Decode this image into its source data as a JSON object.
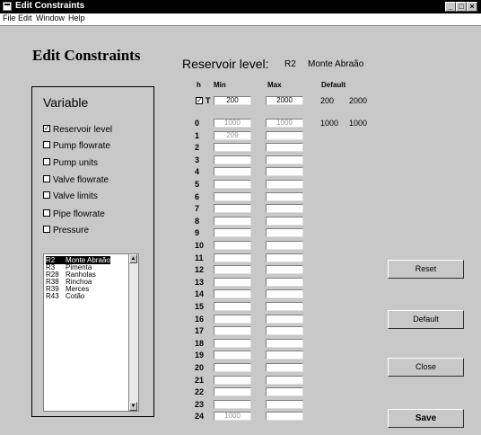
{
  "window": {
    "title": "Edit Constraints",
    "controls": [
      "_",
      "□",
      "×"
    ]
  },
  "menu": [
    "File",
    "Edit",
    "Window",
    "Help"
  ],
  "heading": "Edit Constraints",
  "reservoir": {
    "label": "Reservoir level:",
    "code": "R2",
    "name": "Monte Abraão"
  },
  "variable": {
    "title": "Variable",
    "options": [
      {
        "label": "Reservoir level",
        "checked": true
      },
      {
        "label": "Pump flowrate",
        "checked": false
      },
      {
        "label": "Pump units",
        "checked": false
      },
      {
        "label": "Valve flowrate",
        "checked": false
      },
      {
        "label": "Valve limits",
        "checked": false
      },
      {
        "label": "Pipe flowrate",
        "checked": false
      },
      {
        "label": "Pressure",
        "checked": false
      }
    ]
  },
  "reservoir_list": [
    {
      "code": "R2",
      "name": "Monte Abraão",
      "selected": true
    },
    {
      "code": "R3",
      "name": "Pimenta",
      "selected": false
    },
    {
      "code": "R28",
      "name": "Ranholas",
      "selected": false
    },
    {
      "code": "R38",
      "name": "Rinchoa",
      "selected": false
    },
    {
      "code": "R39",
      "name": "Merces",
      "selected": false
    },
    {
      "code": "R43",
      "name": "Cotão",
      "selected": false
    }
  ],
  "grid": {
    "headers": {
      "h": "h",
      "min": "Min",
      "max": "Max",
      "default": "Default"
    },
    "t_row": {
      "checked": true,
      "label": "T",
      "min": "200",
      "max": "2000",
      "def_min": "200",
      "def_max": "2000"
    },
    "rows": [
      {
        "h": "0",
        "min": "1000",
        "max": "1000",
        "def_min": "1000",
        "def_max": "1000"
      },
      {
        "h": "1",
        "min": "209",
        "max": ""
      },
      {
        "h": "2",
        "min": "",
        "max": ""
      },
      {
        "h": "3",
        "min": "",
        "max": ""
      },
      {
        "h": "4",
        "min": "",
        "max": ""
      },
      {
        "h": "5",
        "min": "",
        "max": ""
      },
      {
        "h": "6",
        "min": "",
        "max": ""
      },
      {
        "h": "7",
        "min": "",
        "max": ""
      },
      {
        "h": "8",
        "min": "",
        "max": ""
      },
      {
        "h": "9",
        "min": "",
        "max": ""
      },
      {
        "h": "10",
        "min": "",
        "max": ""
      },
      {
        "h": "11",
        "min": "",
        "max": ""
      },
      {
        "h": "12",
        "min": "",
        "max": ""
      },
      {
        "h": "13",
        "min": "",
        "max": ""
      },
      {
        "h": "14",
        "min": "",
        "max": ""
      },
      {
        "h": "15",
        "min": "",
        "max": ""
      },
      {
        "h": "16",
        "min": "",
        "max": ""
      },
      {
        "h": "17",
        "min": "",
        "max": ""
      },
      {
        "h": "18",
        "min": "",
        "max": ""
      },
      {
        "h": "19",
        "min": "",
        "max": ""
      },
      {
        "h": "20",
        "min": "",
        "max": ""
      },
      {
        "h": "21",
        "min": "",
        "max": ""
      },
      {
        "h": "22",
        "min": "",
        "max": ""
      },
      {
        "h": "23",
        "min": "",
        "max": ""
      },
      {
        "h": "24",
        "min": "1000",
        "max": ""
      }
    ]
  },
  "buttons": {
    "reset": "Reset",
    "default": "Default",
    "close": "Close",
    "save": "Save"
  }
}
